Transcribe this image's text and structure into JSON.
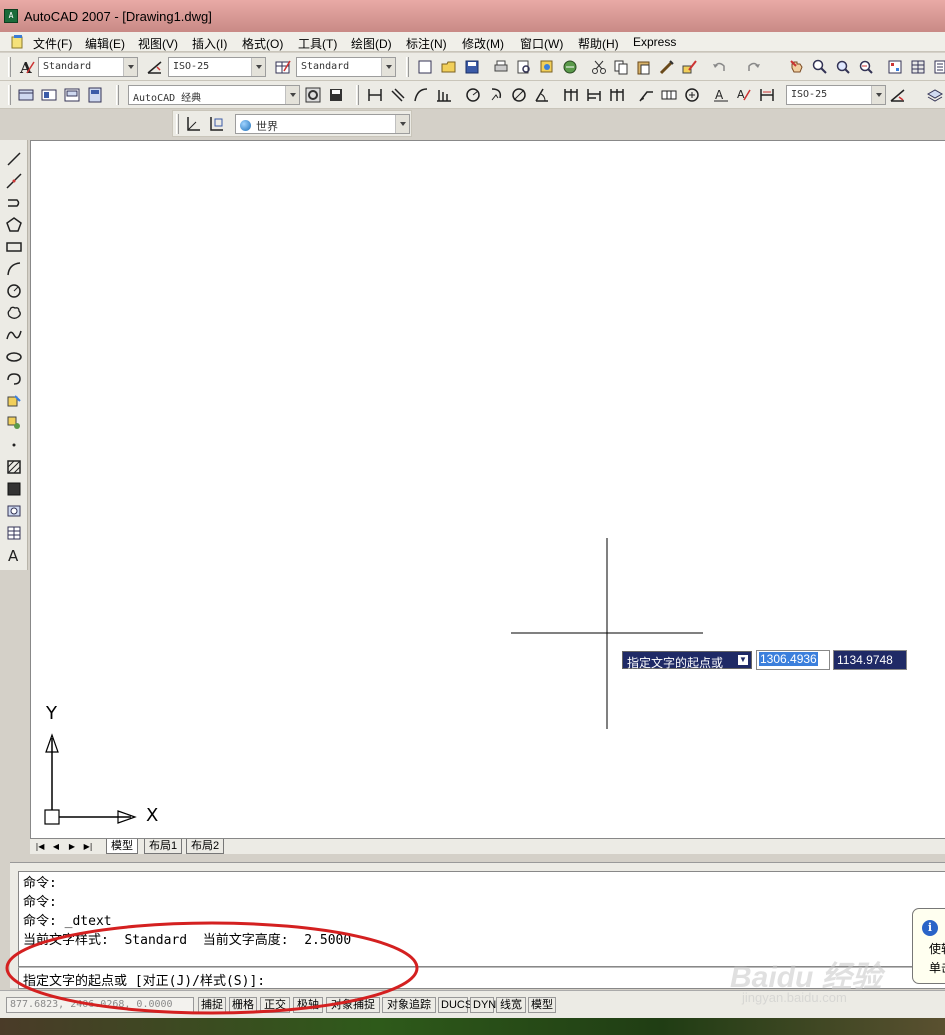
{
  "window": {
    "title": "AutoCAD 2007 - [Drawing1.dwg]",
    "app_icon": "autocad-app-icon"
  },
  "menubar": {
    "items": [
      "文件(F)",
      "编辑(E)",
      "视图(V)",
      "插入(I)",
      "格式(O)",
      "工具(T)",
      "绘图(D)",
      "标注(N)",
      "修改(M)",
      "窗口(W)",
      "帮助(H)",
      "Express"
    ]
  },
  "toolbar_styles": {
    "text_style": "Standard",
    "dim_style": "ISO-25",
    "table_style": "Standard"
  },
  "toolbar_workspace": {
    "workspace": "AutoCAD 经典",
    "dim_style_2": "ISO-25"
  },
  "toolbar_ucs": {
    "ucs": "世界"
  },
  "layout_tabs": {
    "tabs": [
      "模型",
      "布局1",
      "布局2"
    ],
    "active": "模型"
  },
  "command_line": {
    "history": [
      "命令:",
      "命令:",
      "命令: _dtext",
      "当前文字样式:  Standard  当前文字高度:  2.5000"
    ],
    "prompt": "指定文字的起点或 [对正(J)/样式(S)]:"
  },
  "dynamic_input": {
    "label": "指定文字的起点或",
    "x_value": "1306.4936",
    "y_value": "1134.9748"
  },
  "ucs_icon": {
    "x_label": "X",
    "y_label": "Y"
  },
  "status_bar": {
    "coordinates": "877.6823, 2406.0268, 0.0000",
    "buttons": [
      "捕捉",
      "栅格",
      "正交",
      "极轴",
      "对象捕捉",
      "对象追踪",
      "DUCS",
      "DYN",
      "线宽",
      "模型"
    ]
  },
  "balloon": {
    "line1": "使转",
    "line2": "单击"
  },
  "watermark": {
    "main": "Baidu 经验",
    "sub": "jingyan.baidu.com"
  },
  "colors": {
    "annotation": "#d42020",
    "dynamic_input_bg": "#1f2a66",
    "selection": "#3b7fdc"
  }
}
